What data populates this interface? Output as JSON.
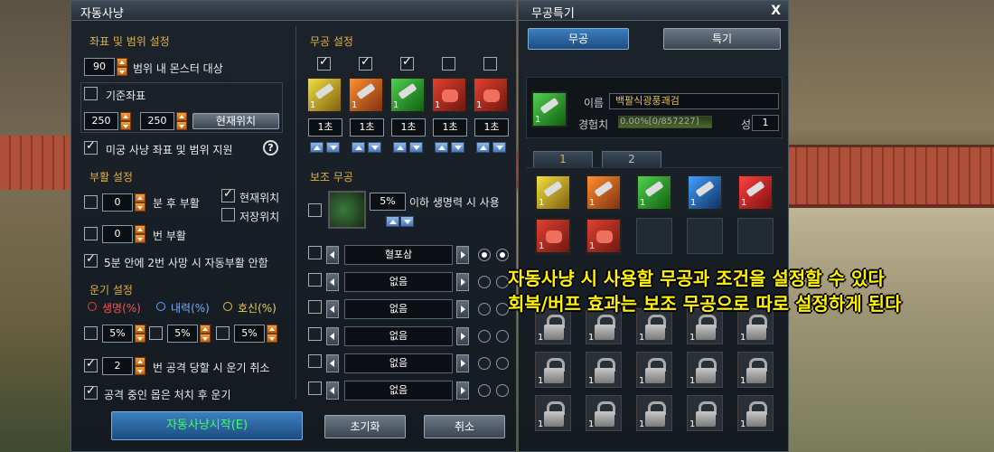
{
  "auto_hunt": {
    "title": "자동사냥",
    "coords_section": "좌표 및 범위 설정",
    "range_value": "90",
    "range_label": "범위 내 몬스터 대상",
    "base_coord_label": "기준좌표",
    "coord_x": "250",
    "coord_y": "250",
    "current_pos_button": "현재위치",
    "dungeon_label": "미궁 사냥 좌표 및 범위 지원",
    "help_icon": "?",
    "revive_section": "부활 설정",
    "revive_min_value": "0",
    "revive_min_label": "분 후 부활",
    "revive_current": "현재위치",
    "revive_saved": "저장위치",
    "revive_count_value": "0",
    "revive_count_label": "번 부활",
    "no_auto_revive_label": "5분 안에 2번 사망 시 자동부활 안함",
    "energy_section": "운기 설정",
    "energy_hp": "생명(%)",
    "energy_mp": "내력(%)",
    "energy_sp": "호신(%)",
    "energy_hp_value": "5%",
    "energy_mp_value": "5%",
    "energy_sp_value": "5%",
    "attack_count_value": "2",
    "attack_count_label": "번 공격 당할 시 운기 취소",
    "after_kill_label": "공격 중인 몹은 처치 후 운기",
    "skill_section": "무공 설정",
    "skill_times": [
      "1초",
      "1초",
      "1초",
      "1초",
      "1초"
    ],
    "skill_checks": [
      true,
      true,
      true,
      false,
      false
    ],
    "aux_section": "보조 무공",
    "aux_percent": "5%",
    "aux_percent_label": "이하 생명력 시 사용",
    "aux_rows": [
      "혈포삼",
      "없음",
      "없음",
      "없음",
      "없음",
      "없음"
    ],
    "start_button": "자동사냥시작(E)",
    "reset_button": "초기화",
    "cancel_button": "취소"
  },
  "skills_window": {
    "title": "무공특기",
    "close": "X",
    "tab_skill": "무공",
    "tab_special": "특기",
    "name_label": "이름",
    "name_value": "백팔식광풍괘검",
    "exp_label": "경험치",
    "exp_value": "0.00%[0/857227]",
    "exp_ratio": 0.0,
    "star_label": "성",
    "star_value": "1",
    "page_tabs": [
      "1",
      "2"
    ],
    "level": "1"
  },
  "caption": {
    "line1": "자동사냥 시 사용할 무공과 조건을 설정할 수 있다",
    "line2": "회복/버프 효과는 보조 무공으로 따로 설정하게 된다"
  }
}
